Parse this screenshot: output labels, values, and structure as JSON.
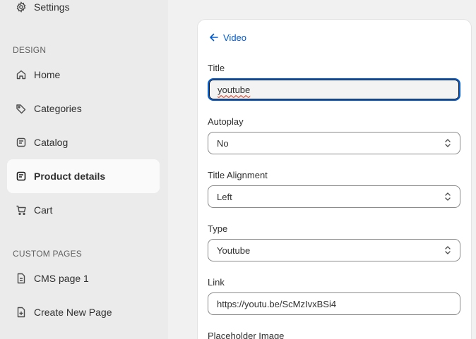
{
  "sidebar": {
    "top_item": {
      "label": "Settings",
      "icon": "gear-icon"
    },
    "design_section": "DESIGN",
    "design_items": [
      {
        "label": "Home",
        "icon": "home-icon"
      },
      {
        "label": "Categories",
        "icon": "tag-icon"
      },
      {
        "label": "Catalog",
        "icon": "catalog-icon"
      },
      {
        "label": "Product details",
        "icon": "product-details-icon",
        "active": true
      },
      {
        "label": "Cart",
        "icon": "cart-icon"
      }
    ],
    "custom_section": "CUSTOM PAGES",
    "custom_items": [
      {
        "label": "CMS page 1",
        "icon": "page-icon"
      },
      {
        "label": "Create New Page",
        "icon": "new-page-icon"
      }
    ]
  },
  "editor": {
    "back_label": "Video",
    "title_label": "Title",
    "title_value": "youtube",
    "autoplay_label": "Autoplay",
    "autoplay_value": "No",
    "alignment_label": "Title Alignment",
    "alignment_value": "Left",
    "type_label": "Type",
    "type_value": "Youtube",
    "link_label": "Link",
    "link_value": "https://youtu.be/ScMzIvxBSi4",
    "placeholder_label": "Placeholder Image"
  },
  "colors": {
    "accent": "#005bd3",
    "active_bg": "#fafafa",
    "sidebar_bg": "#ebebeb"
  }
}
